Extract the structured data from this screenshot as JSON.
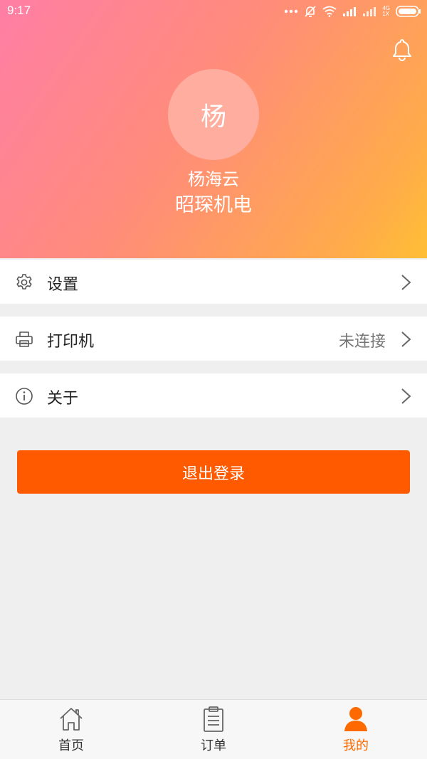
{
  "status_bar": {
    "time": "9:17",
    "network_label_top": "4G",
    "network_label_bottom": "1X"
  },
  "profile": {
    "avatar_initial": "杨",
    "user_name": "杨海云",
    "company_name": "昭琛机电"
  },
  "menu": {
    "settings": {
      "label": "设置",
      "icon": "gear-icon"
    },
    "printer": {
      "label": "打印机",
      "value": "未连接",
      "icon": "printer-icon"
    },
    "about": {
      "label": "关于",
      "icon": "info-icon"
    }
  },
  "logout_label": "退出登录",
  "tabbar": {
    "home": {
      "label": "首页",
      "icon": "home-icon"
    },
    "orders": {
      "label": "订单",
      "icon": "clipboard-icon"
    },
    "mine": {
      "label": "我的",
      "icon": "user-icon",
      "active": true
    }
  },
  "colors": {
    "accent": "#ff5a00",
    "active_tab": "#ff6a00",
    "header_gradient_start": "#ff7ea5",
    "header_gradient_end": "#ffbf35"
  }
}
